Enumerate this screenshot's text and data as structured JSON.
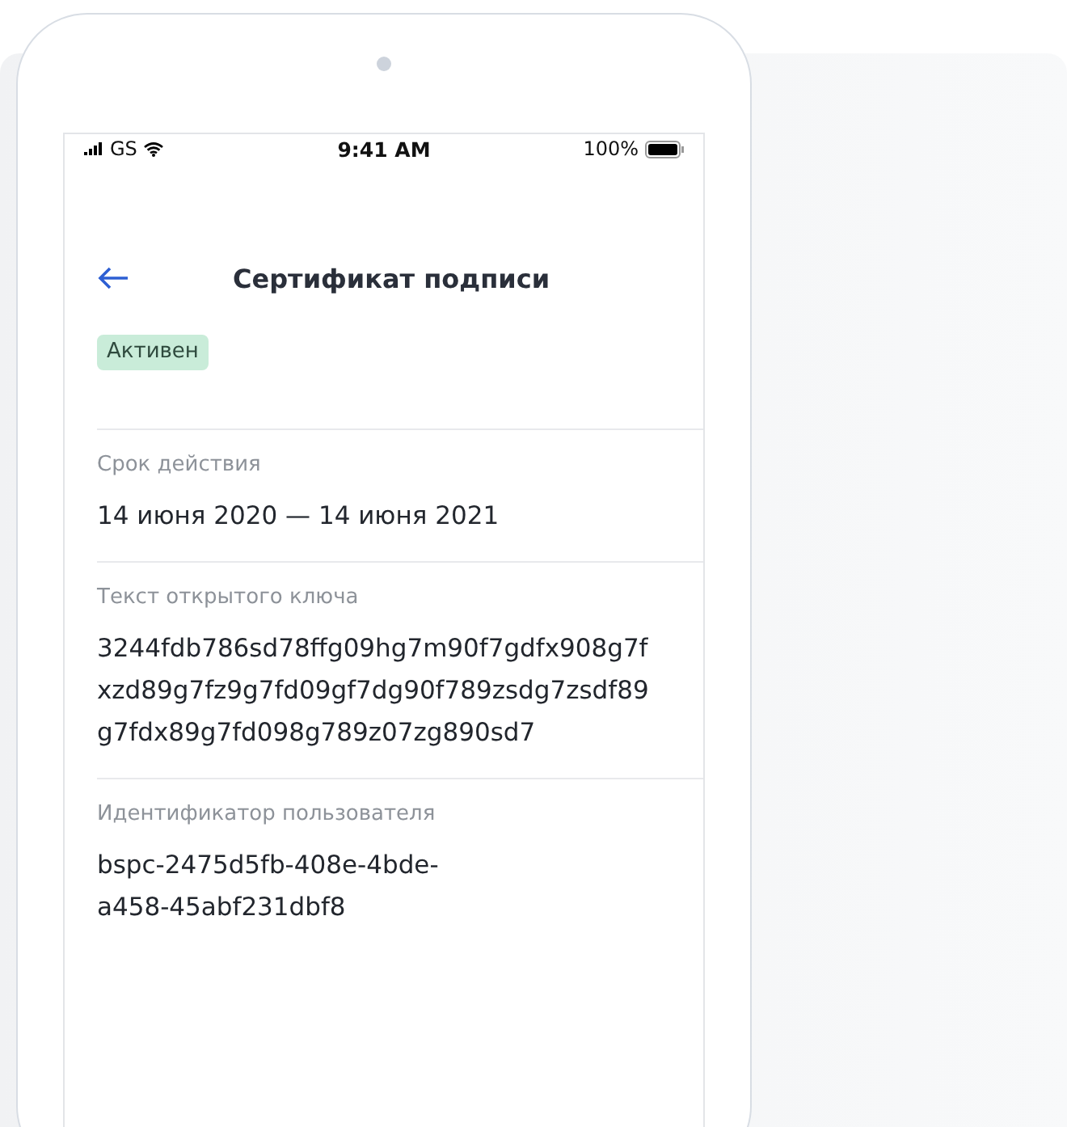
{
  "status_bar": {
    "carrier": "GS",
    "time": "9:41 AM",
    "battery": "100%"
  },
  "header": {
    "title": "Сертификат подписи"
  },
  "badge": {
    "label": "Активен"
  },
  "fields": [
    {
      "label": "Срок действия",
      "value": "14 июня 2020 — 14 июня 2021"
    },
    {
      "label": "Текст открытого ключа",
      "value": "3244fdb786sd78ffg09hg7m90f7gdfx908g7fxzd89g7fz9g7fd09gf7dg90f789zsdg7zsdf89g7fdx89g7fd098g789z07zg890sd7"
    },
    {
      "label": "Идентификатор пользователя",
      "value": "bspc-2475d5fb-408e-4bde-a458-45abf231dbf8"
    }
  ]
}
